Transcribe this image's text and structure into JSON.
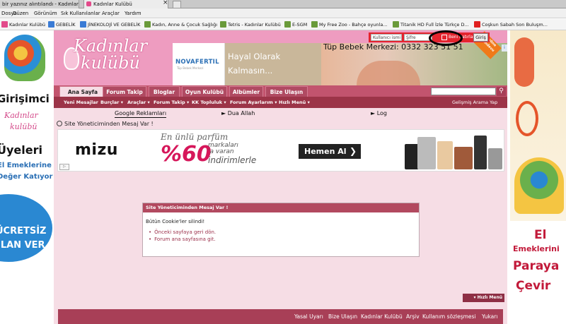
{
  "browser": {
    "tabs": [
      {
        "label": "bir yazınız alıntılandı - Kadınlar K..."
      },
      {
        "label": "Kadınlar Kulübü"
      }
    ],
    "menu": [
      "Dosya",
      "Düzen",
      "Görünüm",
      "Sık Kullanılanlar",
      "Araçlar",
      "Yardım"
    ],
    "bookmarks": [
      {
        "label": "Kadınlar Kulübü",
        "color": "#e24a8a"
      },
      {
        "label": "GEBELİK",
        "color": "#3a7bd5"
      },
      {
        "label": "JİNEKOLOJİ VE GEBELİK",
        "color": "#3a7bd5"
      },
      {
        "label": "Kadın, Anne & Çocuk Sağlığı",
        "color": "#6a9a3a"
      },
      {
        "label": "Tetris - Kadınlar Kulübü",
        "color": "#6a9a3a"
      },
      {
        "label": "E-SGM",
        "color": "#6a9a3a"
      },
      {
        "label": "My Free Zoo - Bahçe oyunla...",
        "color": "#6a9a3a"
      },
      {
        "label": "Titanik HD Full İzle Türkçe D...",
        "color": "#6a9a3a"
      },
      {
        "label": "Coşkun Sabah Son Buluşm...",
        "color": "#e02020"
      }
    ]
  },
  "header": {
    "logo_line1": "Kadınlar",
    "logo_line2": "kulübü",
    "ad_brand": "NOVAFERTIL",
    "ad_brand_sub": "Tüp Bebek Merkezi",
    "ad_line1": "Hayal Olarak",
    "ad_line2": "Kalmasın...",
    "ad_phone": "Tüp Bebek Merkezi: 0332 323 51 51",
    "ad_ribbon": "Online Randevu",
    "ad_choice_icon": "adchoices-icon"
  },
  "login": {
    "username_placeholder": "Kullanıcı ismi",
    "password_placeholder": "Şifre",
    "remember_label": "Beni hatırla",
    "login_button": "Giriş"
  },
  "nav": {
    "tabs": [
      "Ana Sayfa",
      "Forum Takip",
      "Bloglar",
      "Oyun Kulübü",
      "Albümler",
      "Bize Ulaşın"
    ],
    "search_icon": "search-icon"
  },
  "subnav": {
    "items": [
      "Yeni Mesajlar",
      "Burçlar ▾",
      "Araçlar ▾",
      "Forum Takip ▾",
      "KK Topluluk ▾",
      "Forum Ayarlarım ▾",
      "Hızlı Menü ▾"
    ],
    "advanced_search": "Gelişmiş Arama Yap"
  },
  "links": {
    "google": "Google Reklamları",
    "dua": "► Dua Allah",
    "log": "► Log"
  },
  "breadcrumb": "Site Yöneticiminden Mesaj Var !",
  "ad2": {
    "brand": "mizu",
    "line1": "En ünlü parfüm",
    "percent": "%60",
    "line2a": "markaları",
    "line2b": "'a varan",
    "line3": "indirimlerle",
    "button": "Hemen Al",
    "info": "▷"
  },
  "message": {
    "title": "Site Yöneticiminden Mesaj Var !",
    "text": "Bütün Cookie'ler silindi!",
    "links": [
      "Önceki sayfaya geri dön.",
      "Forum ana sayfasına git."
    ]
  },
  "quick_menu": "▾ Hızlı Menü",
  "footer": [
    "Yasal Uyarı",
    "Bize Ulaşın",
    "Kadınlar Kulübü",
    "Arşiv",
    "Kullanım sözleşmesi",
    "Yukarı"
  ],
  "side_left": {
    "t1": "Girişimci",
    "t2": "Kadınlar",
    "t3": "kulübü",
    "t4": "Üyeleri",
    "t5": "El Emeklerine",
    "t6": "Değer Katıyor",
    "t7": "ÜCRETSİZ",
    "t8": "İLAN VER"
  },
  "side_right": {
    "t1": "El",
    "t2": "Emeklerini",
    "t3": "Paraya",
    "t4": "Çevir"
  }
}
